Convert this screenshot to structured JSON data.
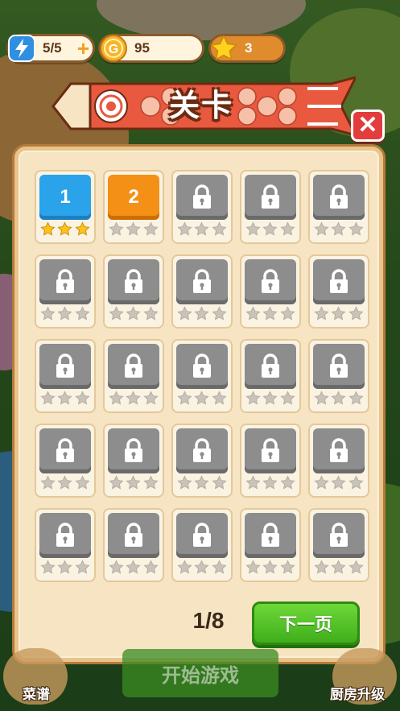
{
  "topbar": {
    "energy": "5/5",
    "energy_plus": "+",
    "coins": "95",
    "stars": "3"
  },
  "header": {
    "title": "关卡",
    "close_label": "✕"
  },
  "levels": [
    {
      "label": "1",
      "state": "complete",
      "stars": 3
    },
    {
      "label": "2",
      "state": "current",
      "stars": 0
    },
    {
      "label": "",
      "state": "locked",
      "stars": 0
    },
    {
      "label": "",
      "state": "locked",
      "stars": 0
    },
    {
      "label": "",
      "state": "locked",
      "stars": 0
    },
    {
      "label": "",
      "state": "locked",
      "stars": 0
    },
    {
      "label": "",
      "state": "locked",
      "stars": 0
    },
    {
      "label": "",
      "state": "locked",
      "stars": 0
    },
    {
      "label": "",
      "state": "locked",
      "stars": 0
    },
    {
      "label": "",
      "state": "locked",
      "stars": 0
    },
    {
      "label": "",
      "state": "locked",
      "stars": 0
    },
    {
      "label": "",
      "state": "locked",
      "stars": 0
    },
    {
      "label": "",
      "state": "locked",
      "stars": 0
    },
    {
      "label": "",
      "state": "locked",
      "stars": 0
    },
    {
      "label": "",
      "state": "locked",
      "stars": 0
    },
    {
      "label": "",
      "state": "locked",
      "stars": 0
    },
    {
      "label": "",
      "state": "locked",
      "stars": 0
    },
    {
      "label": "",
      "state": "locked",
      "stars": 0
    },
    {
      "label": "",
      "state": "locked",
      "stars": 0
    },
    {
      "label": "",
      "state": "locked",
      "stars": 0
    },
    {
      "label": "",
      "state": "locked",
      "stars": 0
    },
    {
      "label": "",
      "state": "locked",
      "stars": 0
    },
    {
      "label": "",
      "state": "locked",
      "stars": 0
    },
    {
      "label": "",
      "state": "locked",
      "stars": 0
    },
    {
      "label": "",
      "state": "locked",
      "stars": 0
    }
  ],
  "pagination": {
    "page_text": "1/8",
    "next_label": "下一页"
  },
  "bottom": {
    "start_label": "开始游戏",
    "menu_label": "菜谱",
    "upgrade_label": "厨房升级"
  },
  "colors": {
    "complete_tile": "#2aa3ea",
    "current_tile": "#f59016",
    "locked_tile": "#8d8d8d",
    "star_gold": "#ffc21a",
    "star_empty": "#c9c3ba",
    "next_button": "#4fc224",
    "close_button": "#e23c3c"
  }
}
